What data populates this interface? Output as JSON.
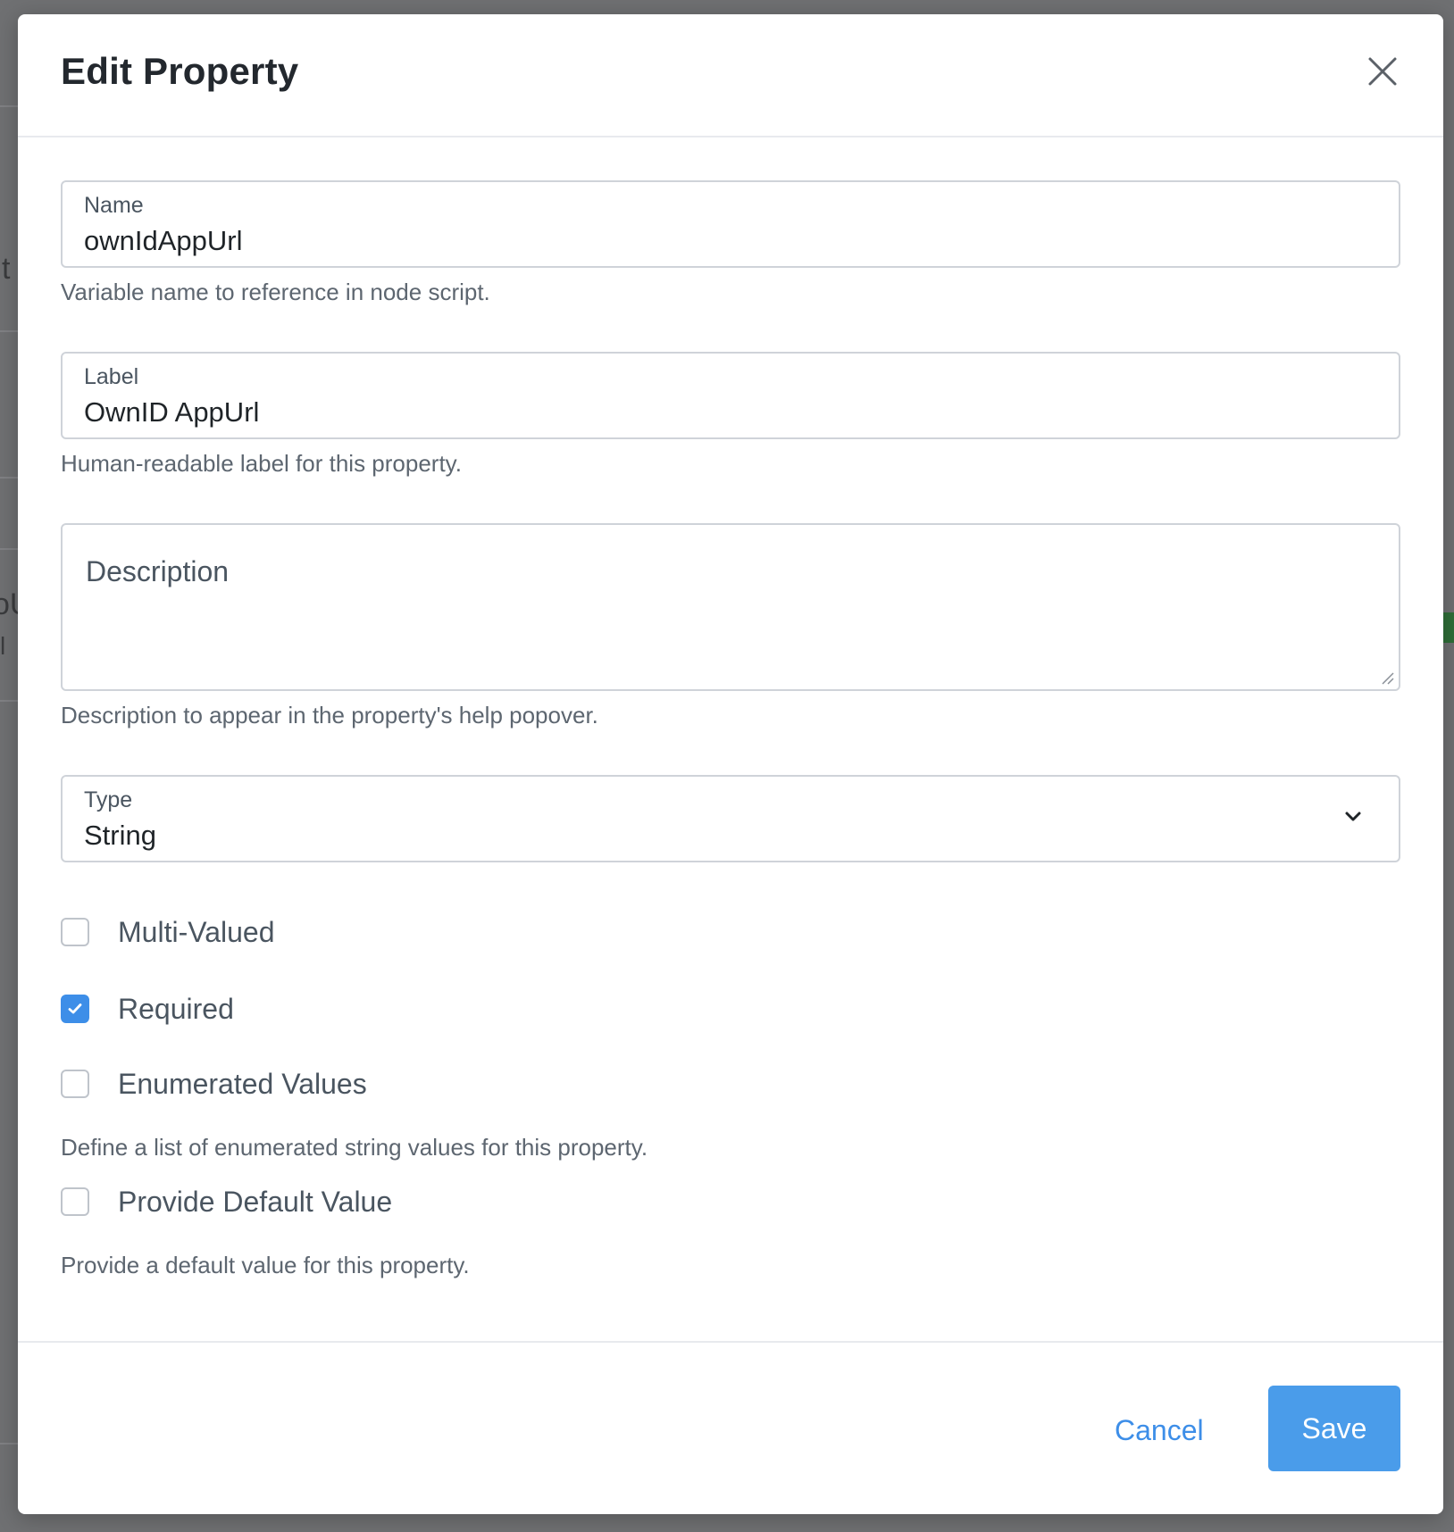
{
  "background": {
    "fragments": [
      "t",
      "oU",
      "l"
    ]
  },
  "modal": {
    "title": "Edit Property",
    "close_icon": "close-icon",
    "fields": {
      "name": {
        "label": "Name",
        "value": "ownIdAppUrl",
        "helper": "Variable name to reference in node script."
      },
      "label": {
        "label": "Label",
        "value": "OwnID AppUrl",
        "helper": "Human-readable label for this property."
      },
      "description": {
        "placeholder": "Description",
        "value": "",
        "helper": "Description to appear in the property's help popover."
      },
      "type": {
        "label": "Type",
        "value": "String",
        "icon": "chevron-down-icon"
      }
    },
    "checkboxes": {
      "multi_valued": {
        "label": "Multi-Valued",
        "checked": false
      },
      "required": {
        "label": "Required",
        "checked": true
      },
      "enumerated_values": {
        "label": "Enumerated Values",
        "checked": false,
        "helper": "Define a list of enumerated string values for this property."
      },
      "provide_default_value": {
        "label": "Provide Default Value",
        "checked": false,
        "helper": "Provide a default value for this property."
      }
    },
    "footer": {
      "cancel_label": "Cancel",
      "save_label": "Save"
    }
  },
  "colors": {
    "accent": "#3d8ee8",
    "save_button": "#4a9cea",
    "overlay": "#6f7072"
  }
}
